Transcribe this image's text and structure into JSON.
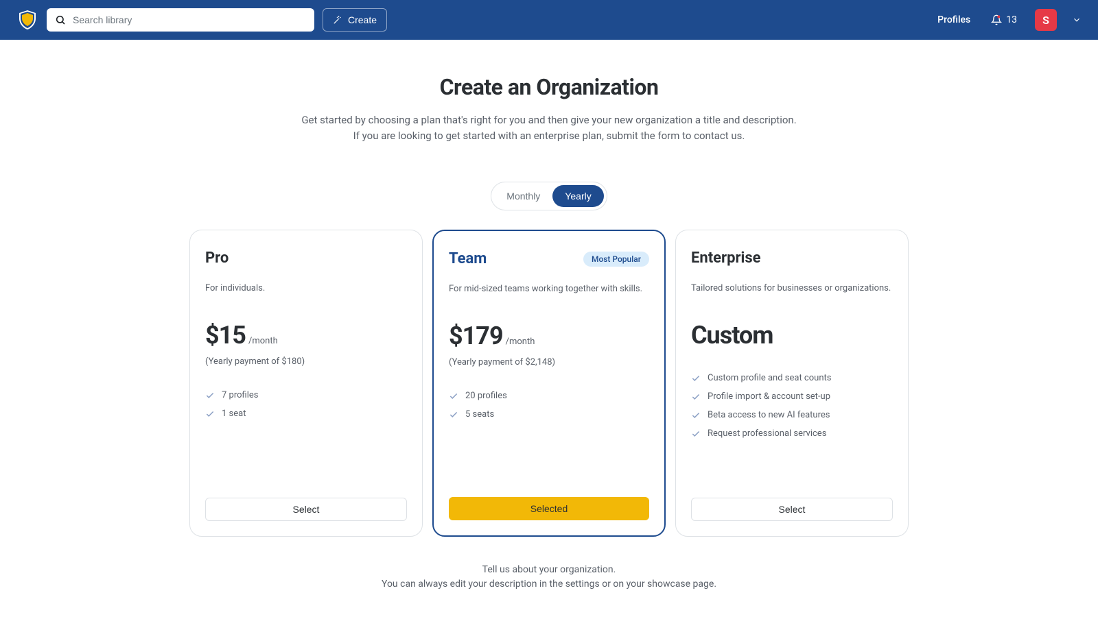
{
  "header": {
    "search_placeholder": "Search library",
    "create_label": "Create",
    "profiles_label": "Profiles",
    "notification_count": "13",
    "avatar_initial": "S"
  },
  "page": {
    "title": "Create an Organization",
    "description_line1": "Get started by choosing a plan that's right for you and then give your new organization a title and description.",
    "description_line2": "If you are looking to get started with an enterprise plan, submit the form to contact us."
  },
  "toggle": {
    "monthly": "Monthly",
    "yearly": "Yearly"
  },
  "plans": {
    "pro": {
      "name": "Pro",
      "desc": "For individuals.",
      "price": "$15",
      "price_unit": "/month",
      "price_note": "(Yearly payment of $180)",
      "features": [
        "7 profiles",
        "1 seat"
      ],
      "button": "Select"
    },
    "team": {
      "name": "Team",
      "badge": "Most Popular",
      "desc": "For mid-sized teams working together with skills.",
      "price": "$179",
      "price_unit": "/month",
      "price_note": "(Yearly payment of $2,148)",
      "features": [
        "20 profiles",
        "5 seats"
      ],
      "button": "Selected"
    },
    "enterprise": {
      "name": "Enterprise",
      "desc": "Tailored solutions for businesses or organizations.",
      "price_custom": "Custom",
      "features": [
        "Custom profile and seat counts",
        "Profile import & account set-up",
        "Beta access to new AI features",
        "Request professional services"
      ],
      "button": "Select"
    }
  },
  "bottom": {
    "line1": "Tell us about your organization.",
    "line2": "You can always edit your description in the settings or on your showcase page."
  }
}
